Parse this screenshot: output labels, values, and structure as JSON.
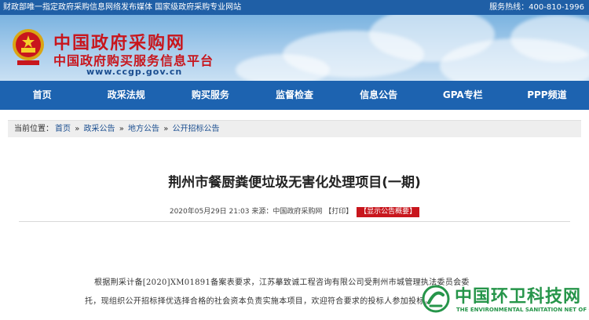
{
  "topbar": {
    "left_text": "财政部唯一指定政府采购信息网络发布媒体 国家级政府采购专业网站",
    "right_text": "服务热线：400-810-1996"
  },
  "brand": {
    "title": "中国政府采购网",
    "subtitle": "中国政府购买服务信息平台",
    "url": "www.ccgp.gov.cn"
  },
  "nav": {
    "items": [
      "首页",
      "政采法规",
      "购买服务",
      "监督检查",
      "信息公告",
      "GPA专栏",
      "PPP频道"
    ]
  },
  "breadcrumb": {
    "label": "当前位置：",
    "items": [
      "首页",
      "政采公告",
      "地方公告",
      "公开招标公告"
    ],
    "separator": "»"
  },
  "article": {
    "title": "荆州市餐厨粪便垃圾无害化处理项目(一期)",
    "meta_date": "2020年05月29日 21:03",
    "meta_source": "来源：中国政府采购网",
    "print_label": "【打印】",
    "summary_label": "【显示公告概要】",
    "paragraph_1": "根据荆采计备[2020]XM01891备案表要求，江苏摹致诚工程咨询有限公司受荆州市城管理执法委员会委",
    "paragraph_2": "托，现组织公开招标择优选择合格的社会资本负责实施本项目，欢迎符合要求的投标人参加投标。"
  },
  "watermark": {
    "title": "中国环卫科技网",
    "subtitle": "THE ENVIRONMENTAL SANITATION NET OF CHINA"
  },
  "colors": {
    "topbar": "#1f5fa6",
    "nav": "#1d63b0",
    "brand_red": "#c8161d",
    "watermark_green": "#26954a"
  }
}
